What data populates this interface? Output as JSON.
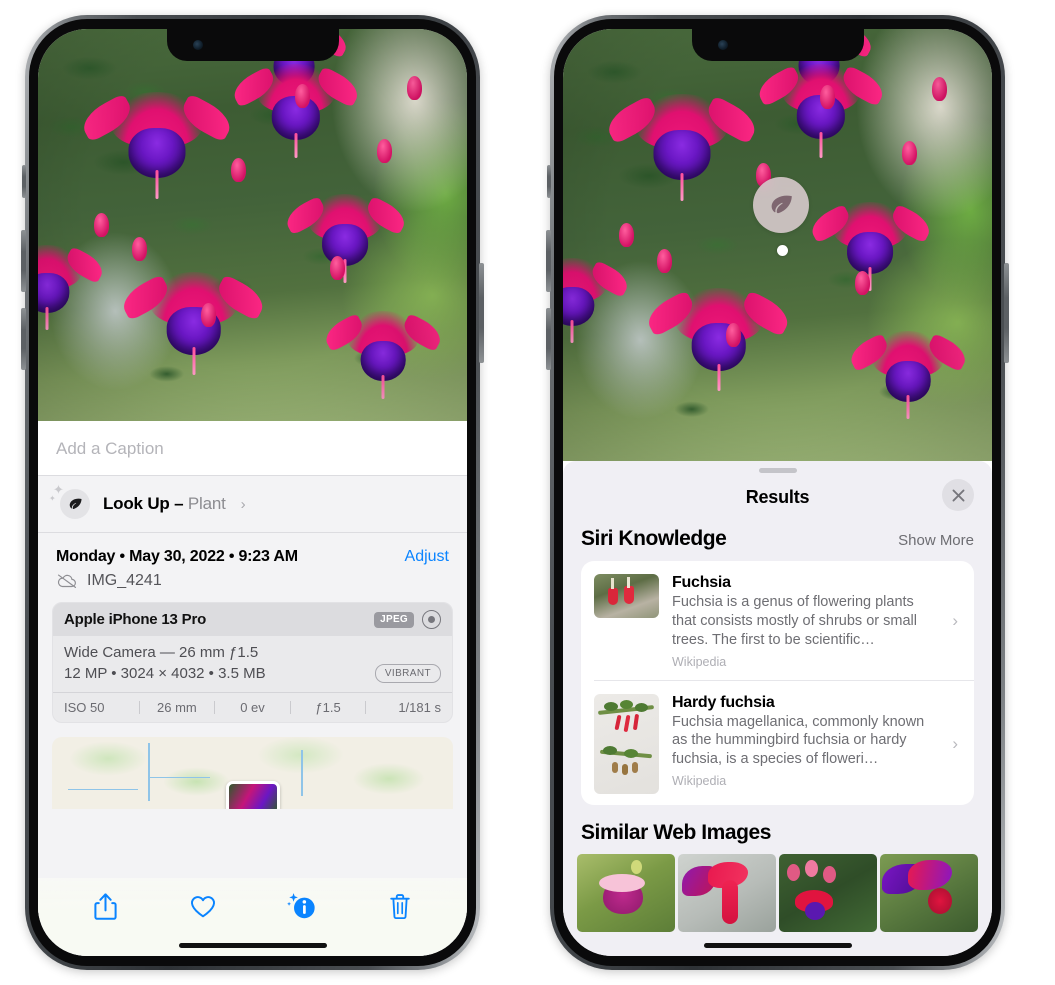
{
  "left_phone": {
    "caption": {
      "placeholder": "Add a Caption",
      "value": ""
    },
    "lookup": {
      "label": "Look Up – ",
      "subject": "Plant",
      "chevron": "›",
      "icon": "leaf-icon",
      "sparkle": "✦"
    },
    "meta": {
      "date": "Monday • May 30, 2022 • 9:23 AM",
      "adjust_label": "Adjust",
      "filename": "IMG_4241",
      "cloud_icon": "cloud-slash-icon"
    },
    "camera": {
      "model": "Apple iPhone 13 Pro",
      "format_badge": "JPEG",
      "raw_icon": "raw-ring-icon",
      "lens": "Wide Camera — 26 mm ƒ1.5",
      "dimensions": "12 MP • 3024 × 4032 • 3.5 MB",
      "style_badge": "VIBRANT",
      "exif": [
        "ISO 50",
        "26 mm",
        "0 ev",
        "ƒ1.5",
        "1/181 s"
      ]
    },
    "toolbar": [
      {
        "name": "share-button",
        "icon": "share-icon"
      },
      {
        "name": "favorite-button",
        "icon": "heart-icon"
      },
      {
        "name": "info-button",
        "icon": "info-sparkle-icon"
      },
      {
        "name": "delete-button",
        "icon": "trash-icon"
      }
    ],
    "accent_color": "#0a84ff"
  },
  "right_phone": {
    "visual_lookup_badge": {
      "icon": "leaf-icon",
      "label": ""
    },
    "sheet": {
      "title": "Results",
      "close_icon": "close-icon",
      "sections": [
        {
          "title": "Siri Knowledge",
          "action_label": "Show More",
          "items": [
            {
              "title": "Fuchsia",
              "description": "Fuchsia is a genus of flowering plants that consists mostly of shrubs or small trees. The first to be scientific…",
              "source": "Wikipedia",
              "chevron": "›"
            },
            {
              "title": "Hardy fuchsia",
              "description": "Fuchsia magellanica, commonly known as the hummingbird fuchsia or hardy fuchsia, is a species of floweri…",
              "source": "Wikipedia",
              "chevron": "›"
            }
          ]
        },
        {
          "title": "Similar Web Images",
          "items": [
            {
              "alt": "pink-and-magenta-fuchsia-with-leaves"
            },
            {
              "alt": "red-fuchsia-closeup"
            },
            {
              "alt": "fuchsia-bush-with-buds"
            },
            {
              "alt": "purple-and-red-fuchsia-cluster"
            }
          ]
        }
      ]
    }
  }
}
